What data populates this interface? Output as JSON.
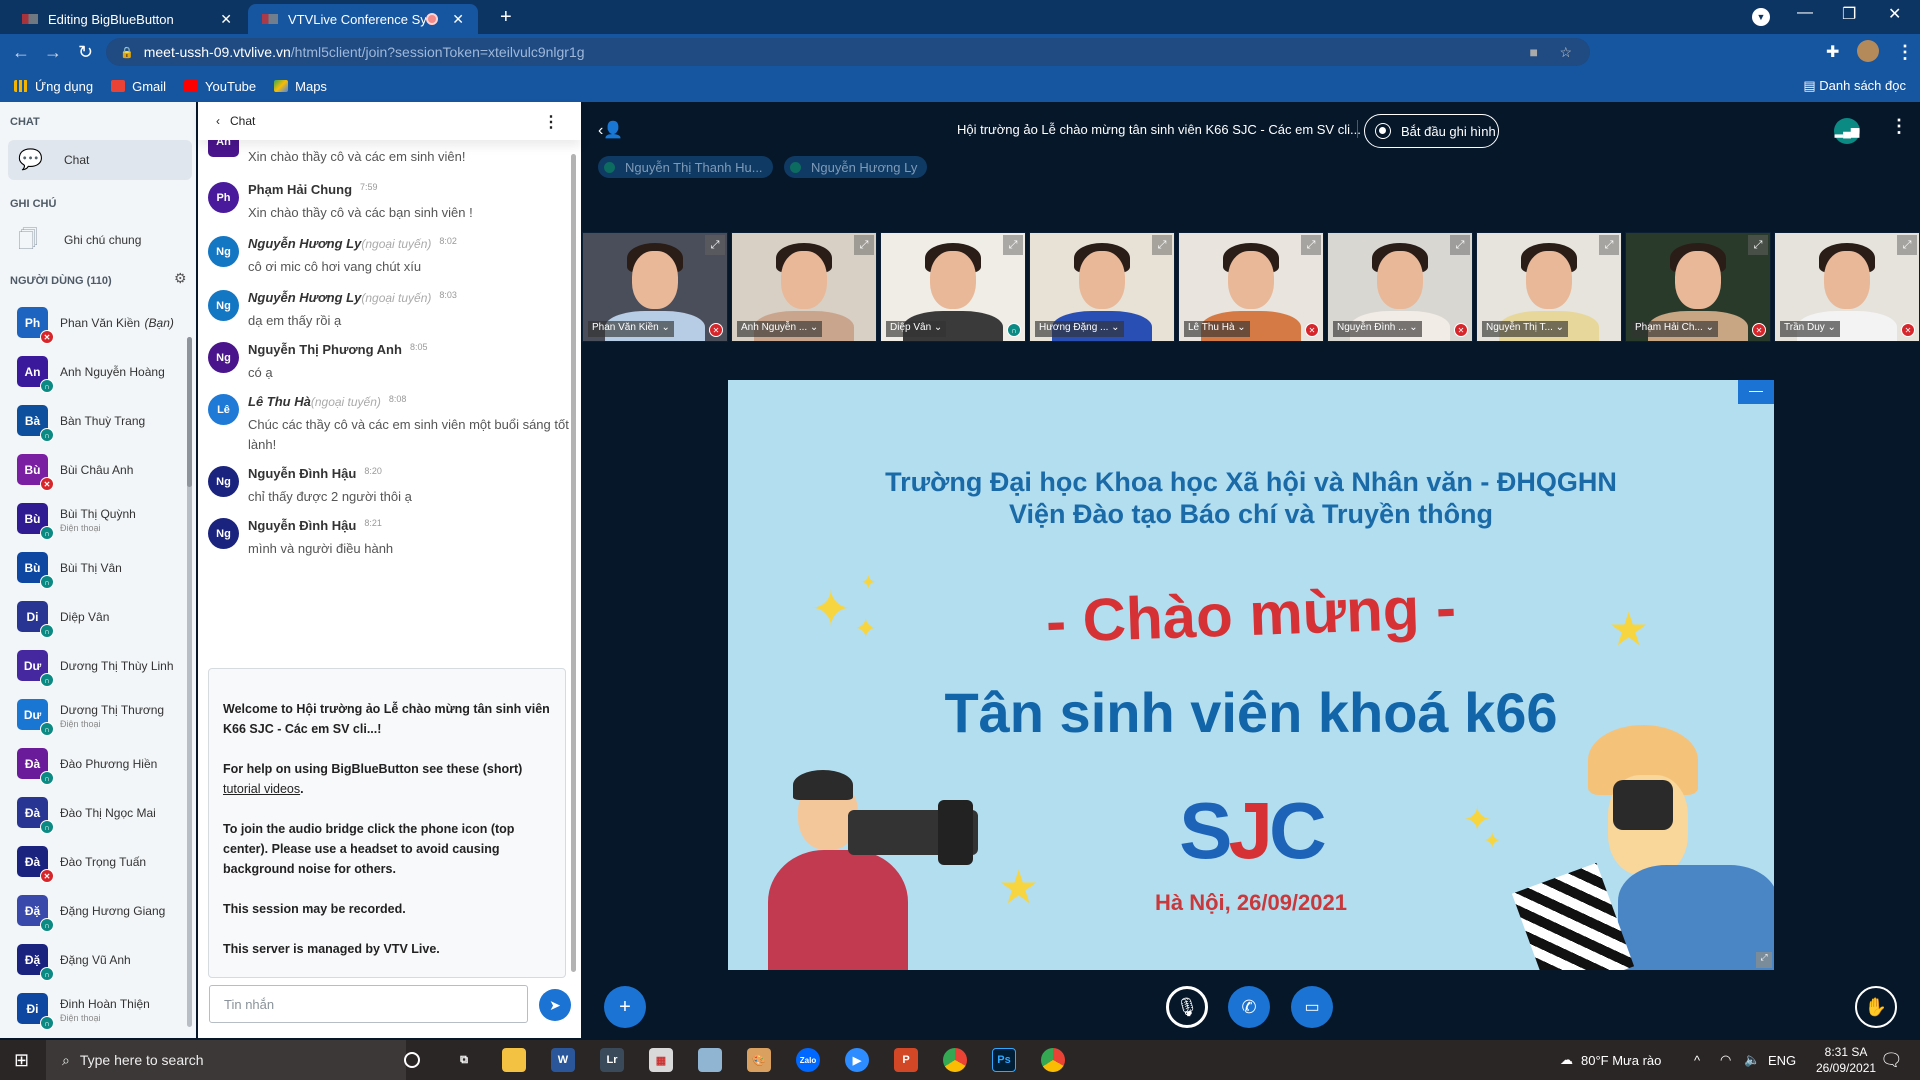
{
  "browser": {
    "tabs": [
      {
        "title": "Editing BigBlueButton",
        "active": false
      },
      {
        "title": "VTVLive Conference System",
        "active": true,
        "recording_indicator": true
      }
    ],
    "new_tab_icon": "plus-icon",
    "url_host": "meet-ussh-09.vtvlive.vn",
    "url_path": "/html5client/join?sessionToken=xteilvulc9nlgr1g",
    "bookmarks": [
      {
        "label": "Ứng dụng",
        "icon": "apps-grid-icon"
      },
      {
        "label": "Gmail",
        "icon": "gmail-icon"
      },
      {
        "label": "YouTube",
        "icon": "youtube-icon"
      },
      {
        "label": "Maps",
        "icon": "maps-icon"
      }
    ],
    "reading_list": "Danh sách đọc"
  },
  "sidebar": {
    "chat_heading": "CHAT",
    "chat_item": "Chat",
    "notes_heading": "GHI CHÚ",
    "notes_item": "Ghi chú chung",
    "users_heading": "NGƯỜI DÙNG (110)",
    "users": [
      {
        "initials": "Ph",
        "name": "Phan Văn Kiền",
        "suffix": "(Bạn)",
        "status": "muted",
        "color": "#1d64c0"
      },
      {
        "initials": "An",
        "name": "Anh Nguyễn Hoàng",
        "status": "listen",
        "color": "#3a1a9a"
      },
      {
        "initials": "Bà",
        "name": "Bàn Thuỳ Trang",
        "status": "listen",
        "color": "#0d4f9c"
      },
      {
        "initials": "Bù",
        "name": "Bùi Châu Anh",
        "status": "muted",
        "color": "#7b1fa2"
      },
      {
        "initials": "Bù",
        "name": "Bùi Thị Quỳnh",
        "sub": "Điện thoại",
        "status": "listen",
        "color": "#311b92"
      },
      {
        "initials": "Bù",
        "name": "Bùi Thị Vân",
        "status": "listen",
        "color": "#0d47a1"
      },
      {
        "initials": "Di",
        "name": "Diệp Vân",
        "status": "listen",
        "color": "#283593"
      },
      {
        "initials": "Dư",
        "name": "Dương Thị Thùy Linh",
        "status": "listen",
        "color": "#4527a0"
      },
      {
        "initials": "Dư",
        "name": "Dương Thị Thương",
        "sub": "Điện thoại",
        "status": "listen",
        "color": "#1976d2"
      },
      {
        "initials": "Đà",
        "name": "Đào Phương Hiền",
        "status": "listen",
        "color": "#6a1b9a"
      },
      {
        "initials": "Đà",
        "name": "Đào Thị Ngọc Mai",
        "status": "listen",
        "color": "#283593"
      },
      {
        "initials": "Đà",
        "name": "Đào Trọng Tuấn",
        "status": "muted",
        "color": "#1a237e"
      },
      {
        "initials": "Đặ",
        "name": "Đặng Hương Giang",
        "status": "listen",
        "color": "#3949ab"
      },
      {
        "initials": "Đặ",
        "name": "Đặng Vũ Anh",
        "status": "listen",
        "color": "#1a237e"
      },
      {
        "initials": "Đi",
        "name": "Đinh Hoàn Thiện",
        "sub": "Điện thoại",
        "status": "listen",
        "color": "#0d47a1"
      }
    ]
  },
  "chat": {
    "back_label": "Chat",
    "messages": [
      {
        "initials": "An",
        "author": "",
        "offline": false,
        "time": "",
        "text": "Xin chào thầy cô và các em sinh viên!",
        "color": "#4a148c",
        "square": true
      },
      {
        "initials": "Ph",
        "author": "Phạm Hải Chung",
        "offline": false,
        "time": "7:59",
        "text": "Xin chào thầy cô và các bạn sinh viên !",
        "color": "#4a1a9c"
      },
      {
        "initials": "Ng",
        "author": "Nguyễn Hương Ly",
        "offline": true,
        "time": "8:02",
        "text": "cô ơi mic cô hơi vang chút xíu",
        "color": "#1477c4"
      },
      {
        "initials": "Ng",
        "author": "Nguyễn Hương Ly",
        "offline": true,
        "time": "8:03",
        "text": "dạ em thấy rồi ạ",
        "color": "#1477c4"
      },
      {
        "initials": "Ng",
        "author": "Nguyễn Thị Phương Anh",
        "offline": false,
        "time": "8:05",
        "text": "có ạ",
        "color": "#4a148c"
      },
      {
        "initials": "Lê",
        "author": "Lê Thu Hà",
        "offline": true,
        "time": "8:08",
        "text": "Chúc các thầy cô và các em sinh viên một buổi sáng tốt lành!",
        "color": "#1e7ad6"
      },
      {
        "initials": "Ng",
        "author": "Nguyễn Đình Hậu",
        "offline": false,
        "time": "8:20",
        "text": "chỉ thấy được 2 người thôi ạ",
        "color": "#1a237e"
      },
      {
        "initials": "Ng",
        "author": "Nguyễn Đình Hậu",
        "offline": false,
        "time": "8:21",
        "text": "mình và người điều hành",
        "color": "#1a237e"
      }
    ],
    "offline_label": "(ngoại tuyến)",
    "welcome": {
      "line1_prefix": "Welcome to ",
      "line1_bold": "Hội trường ảo Lễ chào mừng tân sinh viên K66 SJC - Các em SV cli...!",
      "help_prefix": "For help on using BigBlueButton see these (short) ",
      "help_link": "tutorial videos",
      "help_suffix": ".",
      "audio": "To join the audio bridge click the phone icon (top center). Please use a headset to avoid causing background noise for others.",
      "recorded": "This session may be recorded.",
      "managed": "This server is managed by VTV Live."
    },
    "input_placeholder": "Tin nhắn"
  },
  "main": {
    "meeting_title": "Hội trường ảo Lễ chào mừng tân sinh viên K66 SJC - Các em SV cli...",
    "record_label": "Bắt đầu ghi hình",
    "talkers": [
      "Nguyễn Thị Thanh Hu...",
      "Nguyễn Hương Ly"
    ],
    "videos": [
      {
        "name": "Phan Văn Kiền",
        "status": "muted"
      },
      {
        "name": "Anh Nguyễn ...",
        "status": ""
      },
      {
        "name": "Diệp Vân",
        "status": "listen"
      },
      {
        "name": "Hương Đặng ...",
        "status": ""
      },
      {
        "name": "Lê Thu Hà",
        "status": "muted"
      },
      {
        "name": "Nguyễn Đình ...",
        "status": "muted"
      },
      {
        "name": "Nguyễn Thị T...",
        "status": ""
      },
      {
        "name": "Phạm Hải Ch...",
        "status": "muted"
      },
      {
        "name": "Trần Duy",
        "status": "muted"
      }
    ],
    "slide": {
      "line1": "Trường Đại học Khoa học Xã hội và Nhân văn - ĐHQGHN",
      "line2": "Viện Đào tạo Báo chí và Truyền thông",
      "welcome": "- Chào mừng -",
      "cohort": "Tân sinh viên khoá k66",
      "logo_s": "S",
      "logo_j": "J",
      "logo_c": "C",
      "date": "Hà Nội, 26/09/2021"
    }
  },
  "taskbar": {
    "search_placeholder": "Type here to search",
    "apps": [
      "cortana",
      "task-view",
      "file-explorer",
      "word",
      "lightroom",
      "app",
      "notepad",
      "paint",
      "zalo",
      "zoom",
      "powerpoint",
      "chrome",
      "photoshop",
      "chrome-profile"
    ],
    "weather": "80°F  Mưa rào",
    "language": "ENG",
    "time": "8:31 SA",
    "date": "26/09/2021"
  }
}
